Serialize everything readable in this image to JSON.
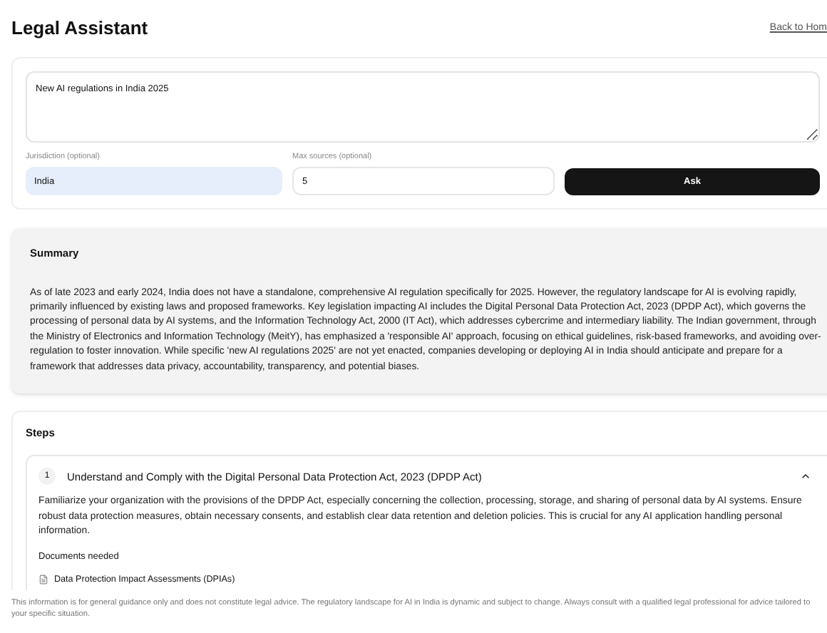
{
  "header": {
    "title": "Legal Assistant",
    "back_link": "Back to Hom"
  },
  "form": {
    "query": "New AI regulations in India 2025",
    "jurisdiction": {
      "label": "Jurisdiction (optional)",
      "value": "India"
    },
    "max_sources": {
      "label": "Max sources (optional)",
      "value": "5"
    },
    "submit": "Ask"
  },
  "summary": {
    "heading": "Summary",
    "text": "As of late 2023 and early 2024, India does not have a standalone, comprehensive AI regulation specifically for 2025. However, the regulatory landscape for AI is evolving rapidly, primarily influenced by existing laws and proposed frameworks. Key legislation impacting AI includes the Digital Personal Data Protection Act, 2023 (DPDP Act), which governs the processing of personal data by AI systems, and the Information Technology Act, 2000 (IT Act), which addresses cybercrime and intermediary liability. The Indian government, through the Ministry of Electronics and Information Technology (MeitY), has emphasized a 'responsible AI' approach, focusing on ethical guidelines, risk-based frameworks, and avoiding over-regulation to foster innovation. While specific 'new AI regulations 2025' are not yet enacted, companies developing or deploying AI in India should anticipate and prepare for a framework that addresses data privacy, accountability, transparency, and potential biases."
  },
  "steps": {
    "heading": "Steps",
    "items": [
      {
        "number": "1",
        "title": "Understand and Comply with the Digital Personal Data Protection Act, 2023 (DPDP Act)",
        "expanded": true,
        "description": "Familiarize your organization with the provisions of the DPDP Act, especially concerning the collection, processing, storage, and sharing of personal data by AI systems. Ensure robust data protection measures, obtain necessary consents, and establish clear data retention and deletion policies. This is crucial for any AI application handling personal information.",
        "documents_heading": "Documents needed",
        "documents": [
          "Data Protection Impact Assessments (DPIAs)"
        ]
      }
    ]
  },
  "disclaimer": "This information is for general guidance only and does not constitute legal advice. The regulatory landscape for AI in India is dynamic and subject to change. Always consult with a qualified legal professional for advice tailored to your specific situation."
}
